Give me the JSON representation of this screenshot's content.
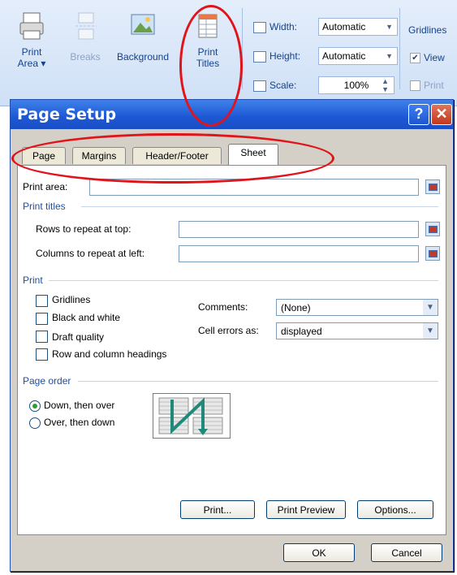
{
  "ribbon": {
    "buttons": {
      "print_area": {
        "line1": "Print",
        "line2": "Area ▾"
      },
      "breaks": {
        "label": "Breaks"
      },
      "background": {
        "label": "Background"
      },
      "print_titles": {
        "line1": "Print",
        "line2": "Titles"
      }
    },
    "scale_to_fit": {
      "width_label": "Width:",
      "width_value": "Automatic",
      "height_label": "Height:",
      "height_value": "Automatic",
      "scale_label": "Scale:",
      "scale_value": "100%"
    },
    "gridlines": {
      "label": "Gridlines",
      "view": "View",
      "print": "Print"
    }
  },
  "dialog": {
    "title": "Page Setup",
    "help": "?",
    "close": "✕",
    "tabs": [
      "Page",
      "Margins",
      "Header/Footer",
      "Sheet"
    ],
    "active_tab": "Sheet",
    "print_area_label": "Print area:",
    "print_titles_section": "Print titles",
    "rows_repeat_label": "Rows to repeat at top:",
    "cols_repeat_label": "Columns to repeat at left:",
    "print_section": "Print",
    "checkboxes": [
      "Gridlines",
      "Black and white",
      "Draft quality",
      "Row and column headings"
    ],
    "comments_label": "Comments:",
    "comments_value": "(None)",
    "cell_errors_label": "Cell errors as:",
    "cell_errors_value": "displayed",
    "page_order_section": "Page order",
    "page_order_options": [
      "Down, then over",
      "Over, then down"
    ],
    "page_order_selected": "Down, then over",
    "print_button": "Print...",
    "print_preview_button": "Print Preview",
    "options_button": "Options...",
    "ok_button": "OK",
    "cancel_button": "Cancel"
  },
  "colors": {
    "highlight_oval": "#e0141a",
    "title_bar": "#1c57d4",
    "section_text": "#1f4fa0"
  }
}
